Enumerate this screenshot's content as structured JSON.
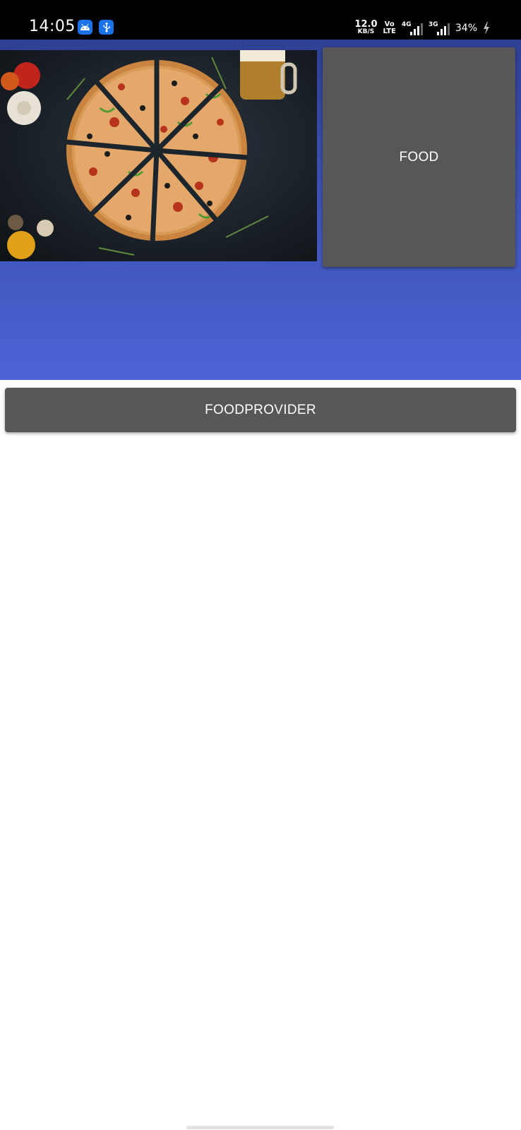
{
  "status_bar": {
    "time": "14:05",
    "icons": [
      "android-icon",
      "usb-icon"
    ],
    "net_speed_value": "12.0",
    "net_speed_unit": "KB/S",
    "volte_top": "Vo",
    "volte_bottom": "LTE",
    "signal1_label": "4G",
    "signal2_label": "3G",
    "battery": "34%",
    "charging": true
  },
  "hero": {
    "image": "pizza-photo",
    "food_label": "FOOD"
  },
  "provider_button_label": "FOODPROVIDER",
  "colors": {
    "hero_top": "#2f3f93",
    "hero_bottom": "#4c63d6",
    "button_bg": "#575759"
  }
}
